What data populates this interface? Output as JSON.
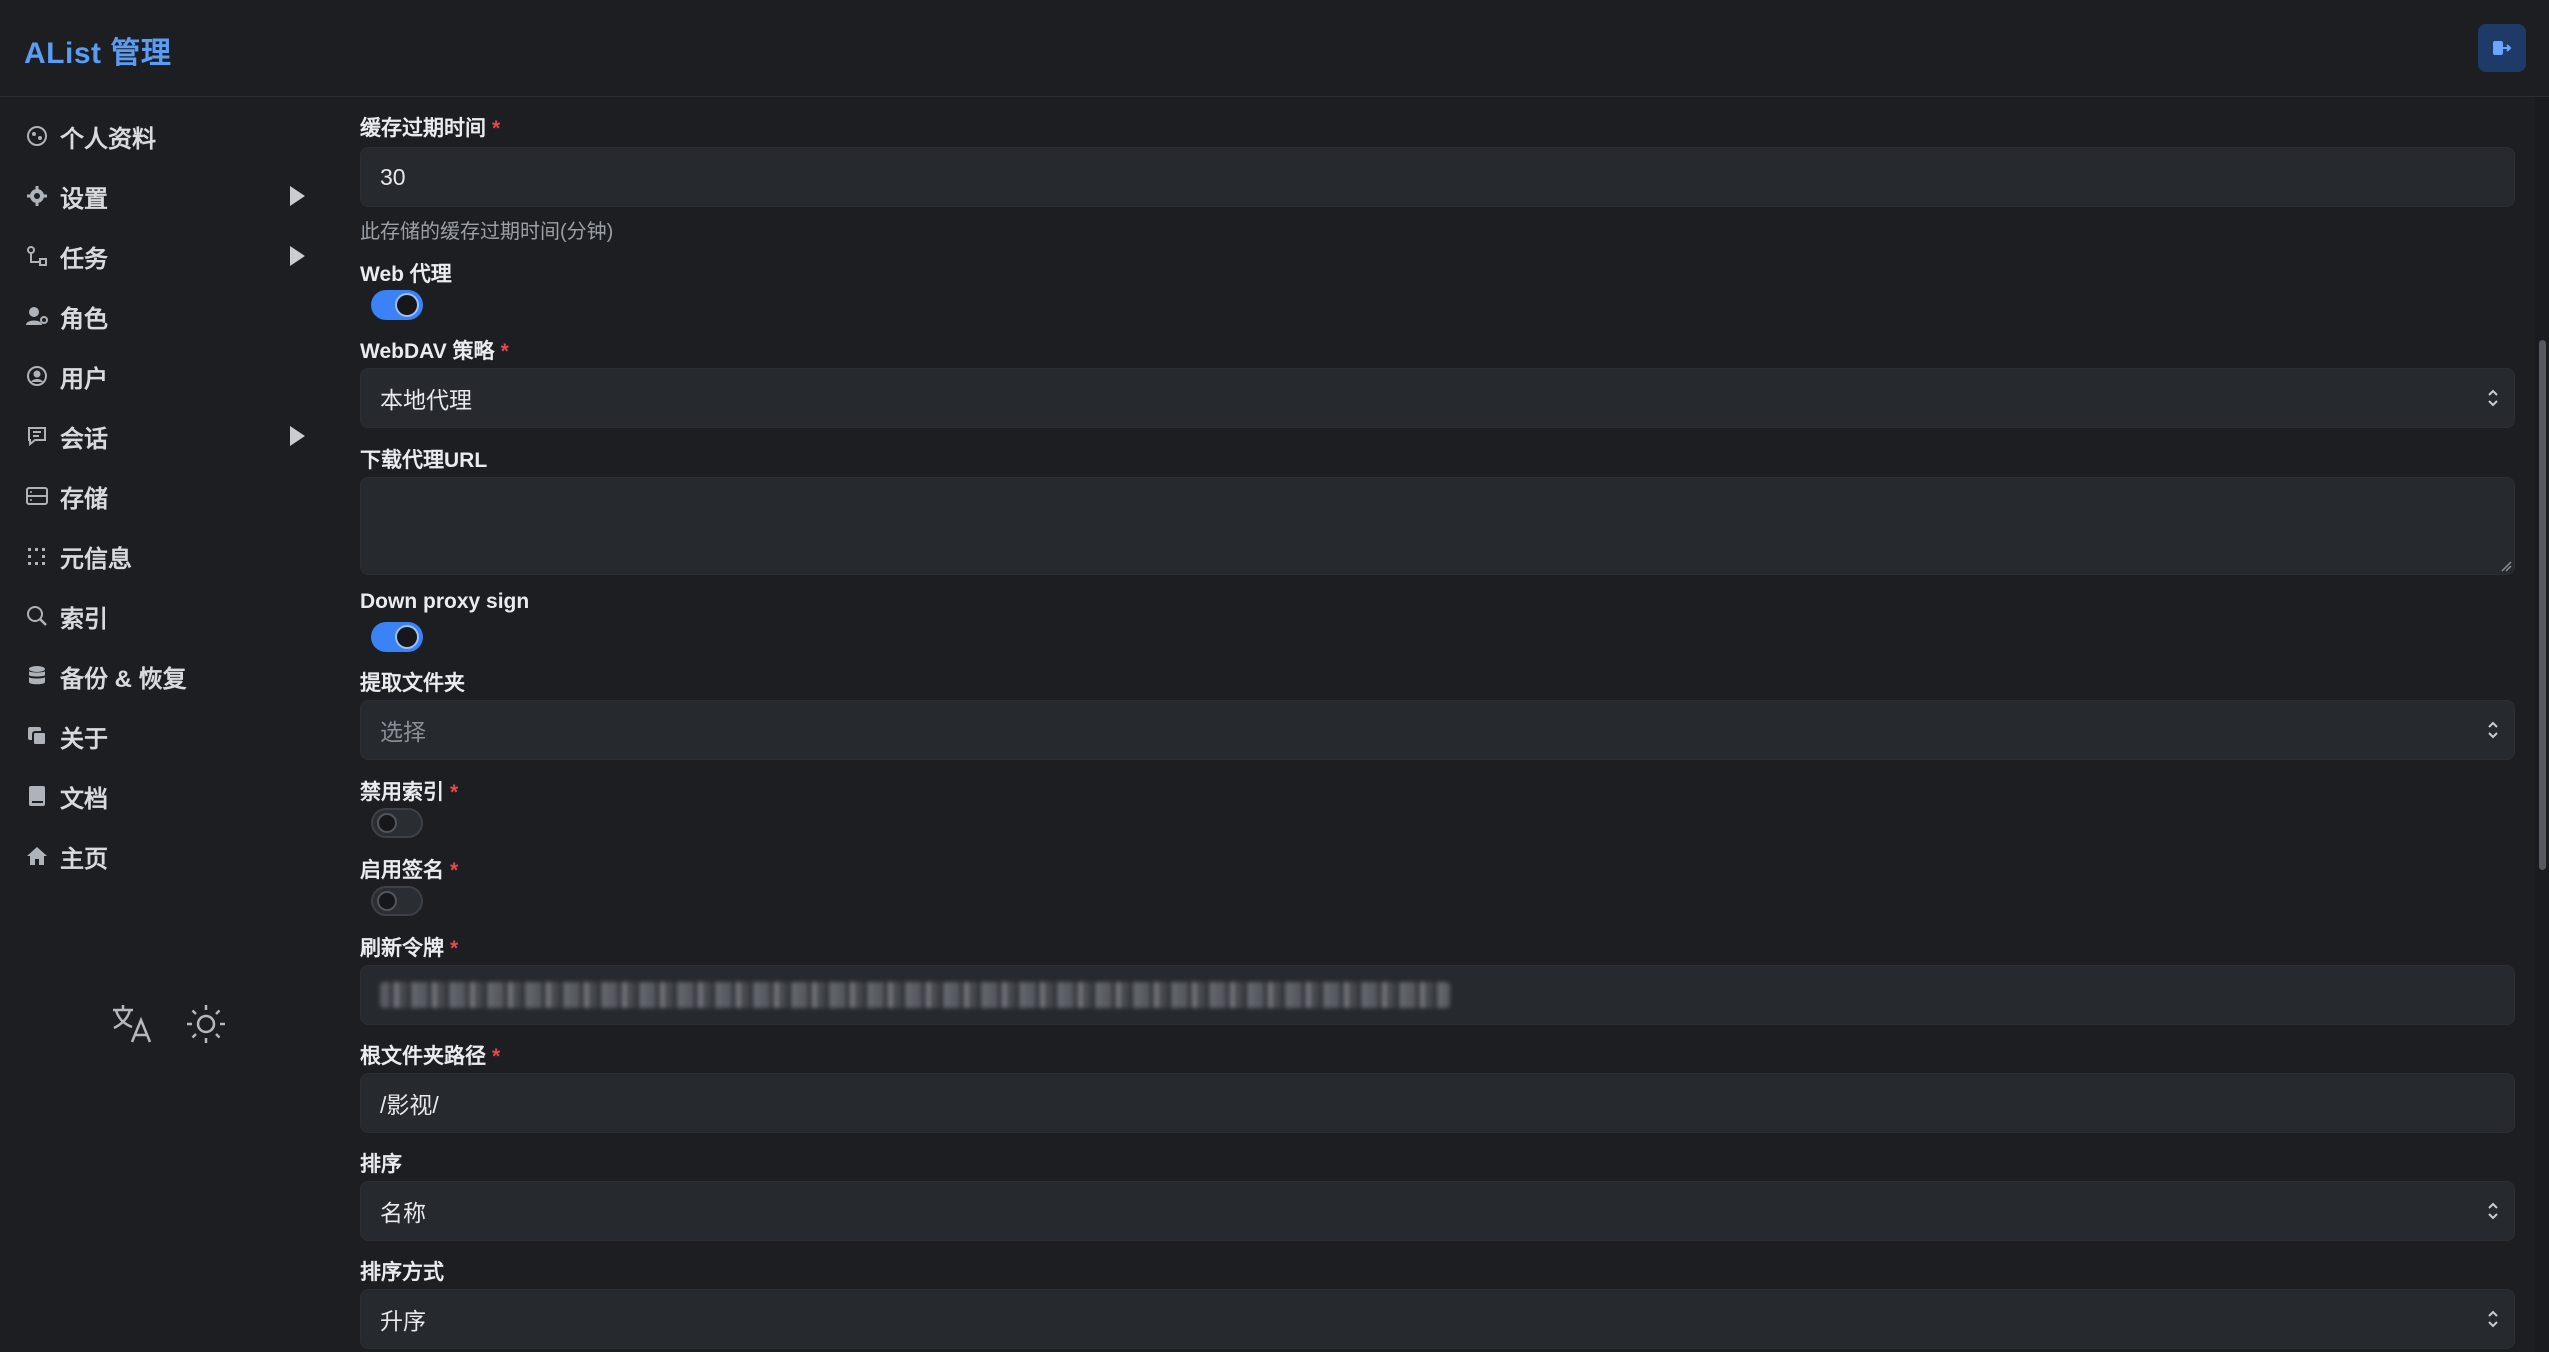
{
  "app": {
    "title": "AList 管理"
  },
  "sidebar": {
    "items": [
      {
        "label": "个人资料",
        "icon": "profile-icon"
      },
      {
        "label": "设置",
        "icon": "gear-icon",
        "expandable": true
      },
      {
        "label": "任务",
        "icon": "task-icon",
        "expandable": true
      },
      {
        "label": "角色",
        "icon": "role-icon"
      },
      {
        "label": "用户",
        "icon": "user-icon"
      },
      {
        "label": "会话",
        "icon": "session-icon",
        "expandable": true
      },
      {
        "label": "存储",
        "icon": "storage-icon"
      },
      {
        "label": "元信息",
        "icon": "meta-icon"
      },
      {
        "label": "索引",
        "icon": "search-icon"
      },
      {
        "label": "备份 & 恢复",
        "icon": "database-icon"
      },
      {
        "label": "关于",
        "icon": "copy-icon"
      },
      {
        "label": "文档",
        "icon": "book-icon"
      },
      {
        "label": "主页",
        "icon": "home-icon"
      }
    ],
    "tools": [
      "translate-icon",
      "sun-icon"
    ]
  },
  "form": {
    "cache_expiration": {
      "label": "缓存过期时间",
      "value": "30",
      "hint": "此存储的缓存过期时间(分钟)",
      "required": "*"
    },
    "web_proxy": {
      "label": "Web 代理",
      "enabled": true
    },
    "webdav_policy": {
      "label": "WebDAV 策略",
      "value": "本地代理",
      "required": "*"
    },
    "download_proxy_url": {
      "label": "下载代理URL",
      "value": ""
    },
    "down_proxy_sign": {
      "label": "Down proxy sign",
      "enabled": true
    },
    "extract_folder": {
      "label": "提取文件夹",
      "placeholder": "选择"
    },
    "disable_index": {
      "label": "禁用索引",
      "enabled": false,
      "required": "*"
    },
    "enable_sign": {
      "label": "启用签名",
      "enabled": false,
      "required": "*"
    },
    "refresh_token": {
      "label": "刷新令牌",
      "required": "*"
    },
    "root_folder_path": {
      "label": "根文件夹路径",
      "value": "/影视/",
      "required": "*"
    },
    "order_by": {
      "label": "排序",
      "value": "名称"
    },
    "order_direction": {
      "label": "排序方式",
      "value": "升序"
    }
  },
  "colors": {
    "accent": "#3b82f6",
    "brand": "#5b9cf4",
    "required": "#e5484d",
    "background": "#1c1e21"
  }
}
